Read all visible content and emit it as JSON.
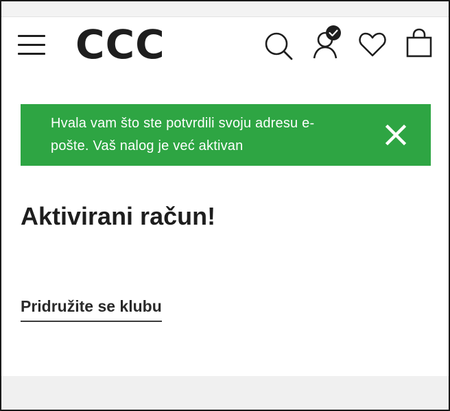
{
  "header": {
    "logo": "CCC",
    "icons": {
      "menu": "hamburger-menu-icon",
      "search": "search-icon",
      "account": "user-account-verified-icon",
      "wishlist": "heart-icon",
      "cart": "shopping-bag-icon"
    }
  },
  "banner": {
    "message_line1": "Hvala vam što ste potvrdili svoju adresu e-",
    "message_line2": "pošte. Vaš nalog je već aktivan",
    "close_icon": "close-icon",
    "color": "#2ea543"
  },
  "main": {
    "title": "Aktivirani račun!",
    "join_link": "Pridružite se klubu"
  }
}
